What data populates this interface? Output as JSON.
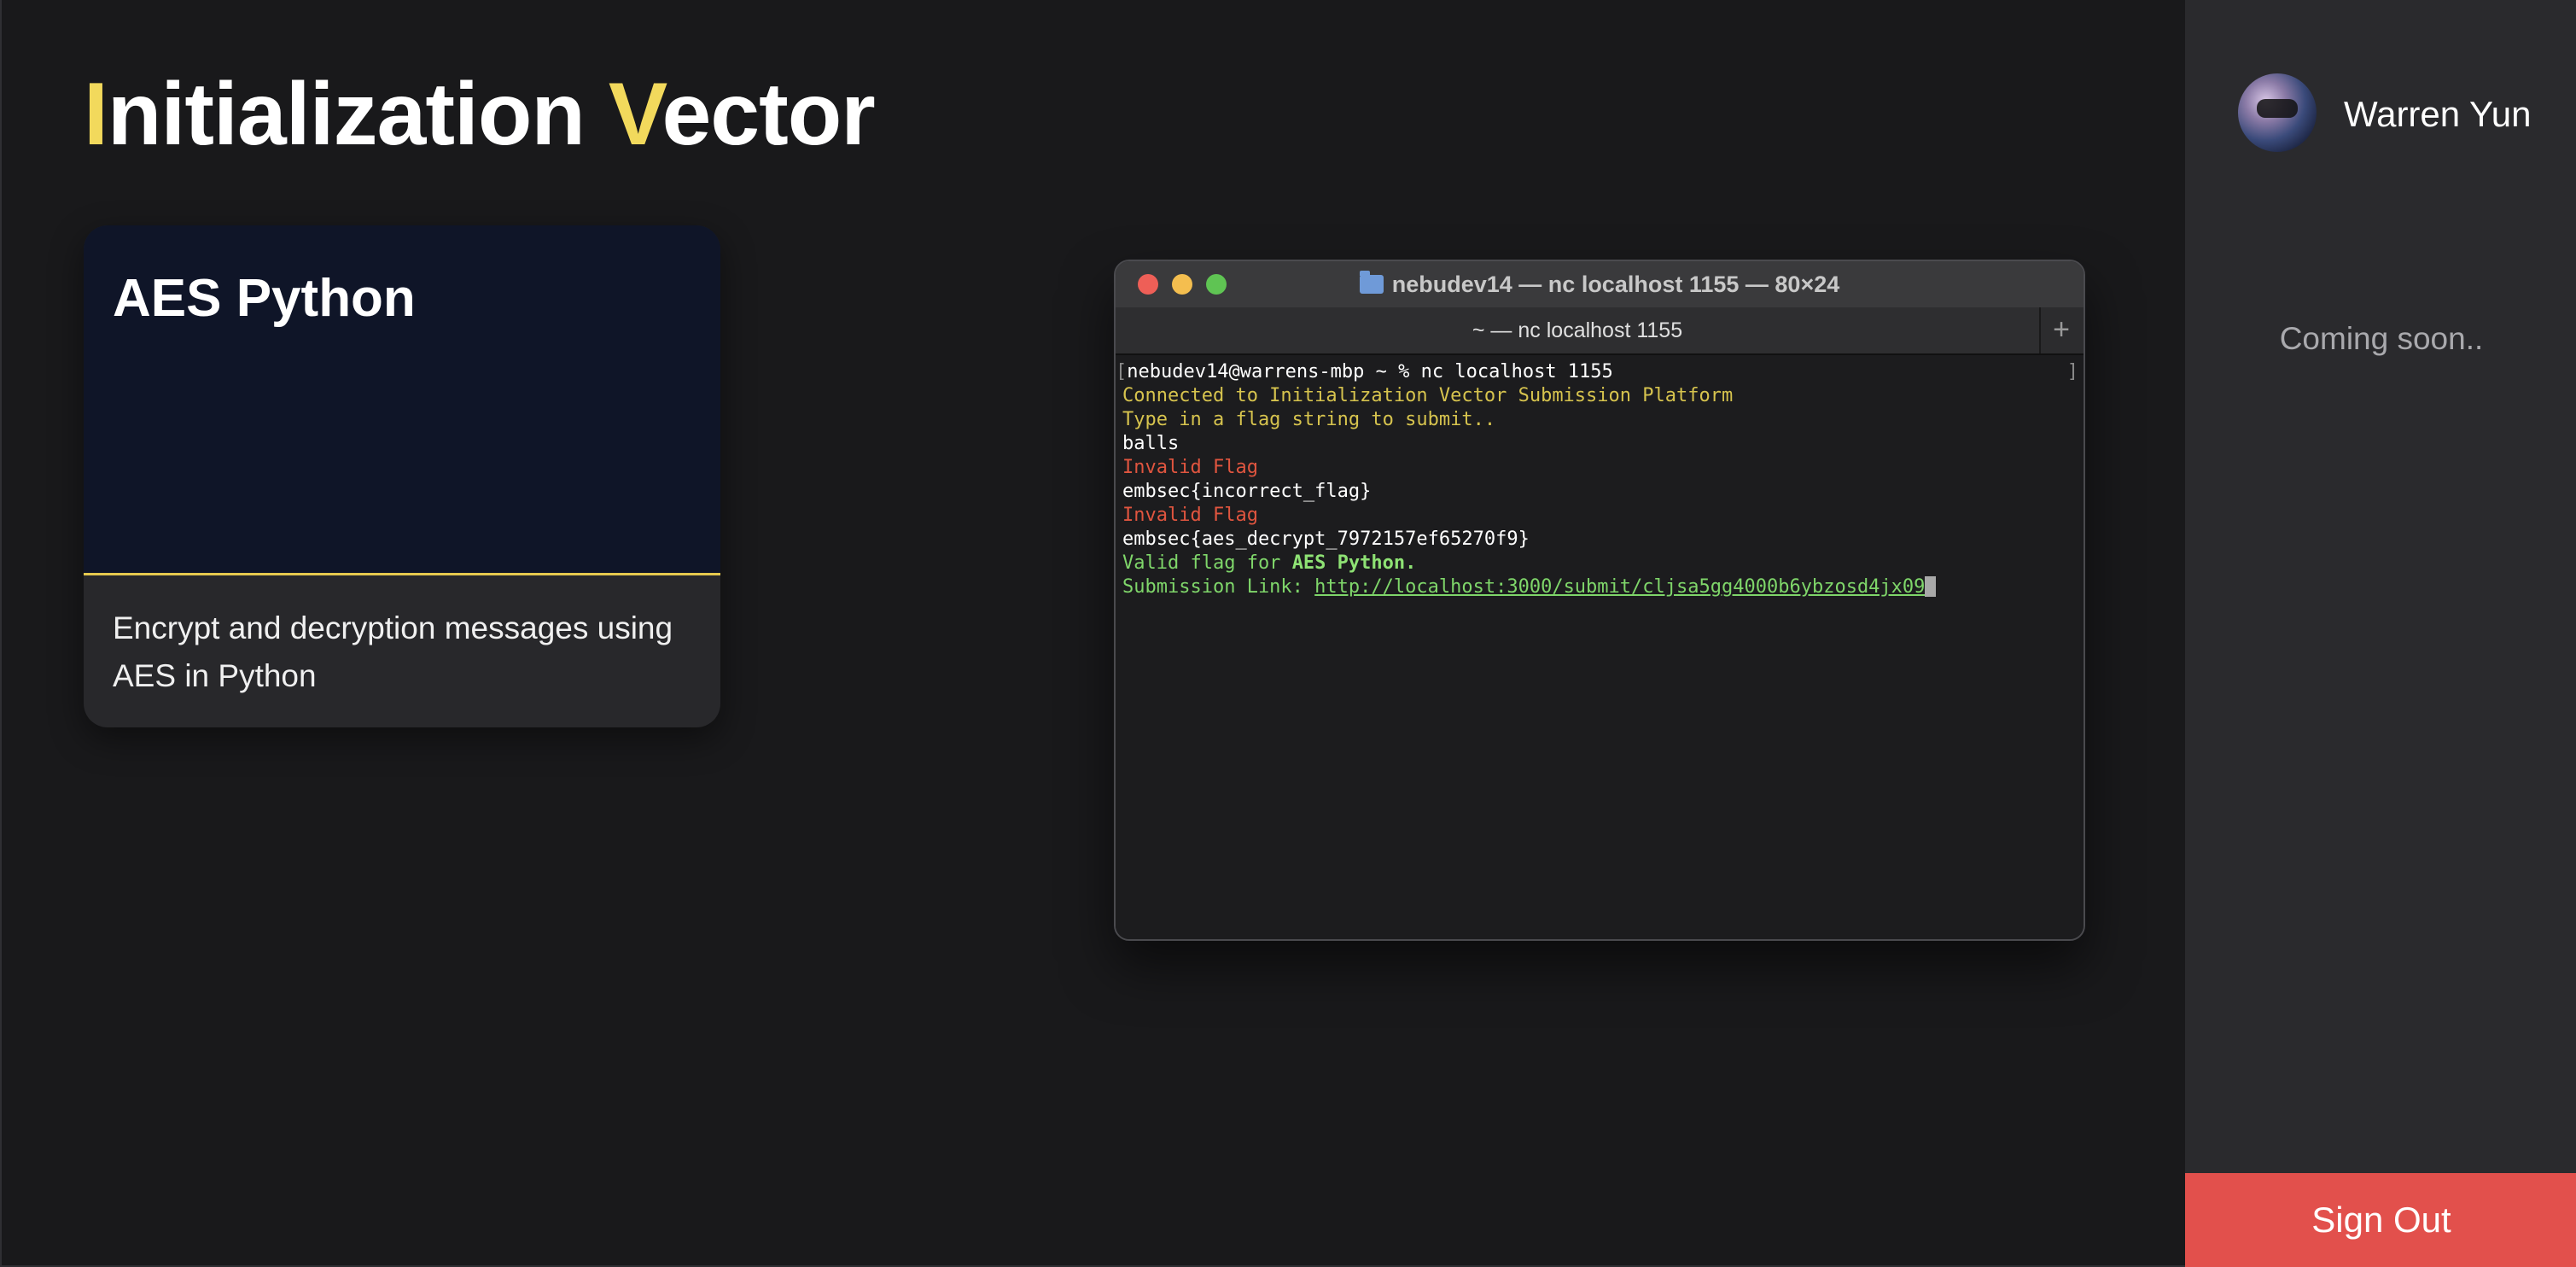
{
  "app": {
    "title_first_letter": "I",
    "title_first_rest": "nitialization ",
    "title_second_letter": "V",
    "title_second_rest": "ector",
    "accent_color": "#f2d95c"
  },
  "challenge_card": {
    "title": "AES Python",
    "description": "Encrypt and decryption messages using AES in Python",
    "border_accent": "#e6c94e"
  },
  "terminal": {
    "window_title": "nebudev14 — nc localhost 1155 — 80×24",
    "folder_icon": "folder-icon",
    "tab_label": "~ — nc localhost 1155",
    "add_tab_label": "+",
    "prompt_open_bracket": "[",
    "close_bracket": "]",
    "lines": {
      "command": "nebudev14@warrens-mbp ~ % nc localhost 1155",
      "connected": "Connected to Initialization Vector Submission Platform",
      "instruction": "Type in a flag string to submit..",
      "input1": "balls",
      "invalid1": "Invalid Flag",
      "input2": "embsec{incorrect_flag}",
      "invalid2": "Invalid Flag",
      "input3": "embsec{aes_decrypt_7972157ef65270f9}",
      "valid_prefix": "Valid flag for ",
      "valid_challenge": "AES Python.",
      "submission_prefix": "Submission Link: ",
      "submission_url": "http://localhost:3000/submit/cljsa5gg4000b6ybzosd4jx09"
    },
    "colors": {
      "info": "#d6c34e",
      "error": "#e0553f",
      "success": "#7fd66a"
    }
  },
  "sidebar": {
    "user_name": "Warren Yun",
    "avatar_icon": "user-avatar",
    "coming_soon": "Coming soon..",
    "sign_out_label": "Sign Out",
    "sign_out_color": "#e2504c"
  }
}
